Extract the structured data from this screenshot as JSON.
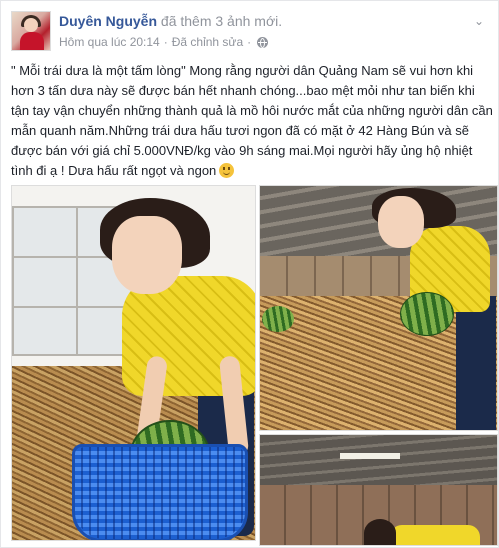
{
  "post": {
    "author": "Duyên Nguyễn",
    "action": "đã thêm 3 ảnh mới.",
    "timestamp": "Hôm qua lúc 20:14",
    "separator": "·",
    "edited": "Đã chỉnh sửa",
    "separator2": "·",
    "privacy_icon": "globe-icon",
    "menu_icon": "chevron-down-icon",
    "text": "\" Mỗi trái dưa là một tấm lòng\" Mong rằng người dân Quảng Nam sẽ vui hơn khi hơn 3 tấn dưa này sẽ được bán hết nhanh chóng...bao mệt mỏi như tan biến khi tận tay vận chuyển những thành quả là mồ hôi nước mắt của những người dân cần mẫn quanh năm.Những trái dưa hấu tươi ngon đã có mặt ở 42 Hàng Bún và sẽ được bán với giá chỉ 5.000VNĐ/kg vào 9h sáng mai.Mọi người hãy ủng hộ nhiệt tình đi ạ ! Dưa hấu rất ngọt và ngon",
    "emoji_icon": "smiley-icon",
    "photos": [
      "photo-1",
      "photo-2",
      "photo-3"
    ]
  },
  "colors": {
    "link": "#365899",
    "meta": "#90949c",
    "text": "#1d2129"
  }
}
